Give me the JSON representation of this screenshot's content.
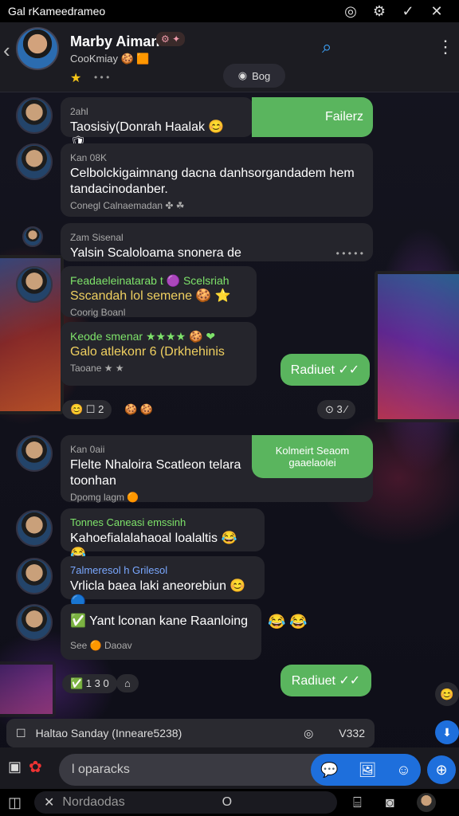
{
  "status": {
    "title": "Gal rKameedrameo",
    "icons": [
      "circle-icon",
      "settings-icon",
      "check-icon",
      "close-icon"
    ]
  },
  "header": {
    "name": "Marby Aiman",
    "chip": "⚙ ✦",
    "subtitle": "CooKmiay 🍪 🟧",
    "star": "★",
    "dots": "• • •",
    "pill": "Bog"
  },
  "messages": [
    {
      "meta": "2ahl",
      "text": "Taosisiy(Donrah Haalak 😊 🛡"
    },
    {
      "meta": "Kan 08K",
      "text": "Celbolckigaimnang dacna danhsorgandadem hem tandacinodanber.",
      "sub": "Conegl Calnaemadan ✤ ☘"
    },
    {
      "meta": "Zam Sisenal",
      "text": "Yalsin Scaloloama snonera de",
      "dots": "• • • • •"
    },
    {
      "meta": "Feadaeleinatarab t 🟣 Scelsriah",
      "text": "Sscandah lol semene 🍪 ⭐",
      "sub": "Coorig Boanl"
    },
    {
      "meta": "Keode smenar ★★★★ 🍪 ❤",
      "text": "Galo atlekonr 6 (Drkhehinis",
      "sub": "Taoane ★ ★"
    },
    {
      "meta": "Kan 0aii",
      "text": "Flelte Nhaloira Scatleon telara toonhan",
      "sub": "Dpomg lagm 🟠"
    },
    {
      "meta": "Tonnes Caneasi emssinh",
      "text": "Kahoefialalahaoal loalaltis 😂 😂"
    },
    {
      "meta": "7almeresol  h Grilesol",
      "text": "Vrlicla baea laki aneorebiun 😊 🔵"
    },
    {
      "text": "✅ Yant lconan kane Raanloing",
      "sub": "See 🟠 Daoav",
      "extra": "😂 😂"
    }
  ],
  "green": [
    "Failerz",
    "Radiuet ✓✓",
    "Kolmeirt Seaom gaaelaolei",
    "Radiuet ✓✓"
  ],
  "reactions": [
    "😊 ☐ 2",
    "🍪 🍪",
    "⊙ 3 ⁄",
    "✅ 1 3 0",
    "⌂"
  ],
  "strip": {
    "icon": "☐",
    "text": "Haltao Sanday (Inneare5238)",
    "right": "V332"
  },
  "composer": {
    "placeholder": "l oparacks"
  },
  "nav": {
    "text": "Nordaodas",
    "mid": "O"
  }
}
